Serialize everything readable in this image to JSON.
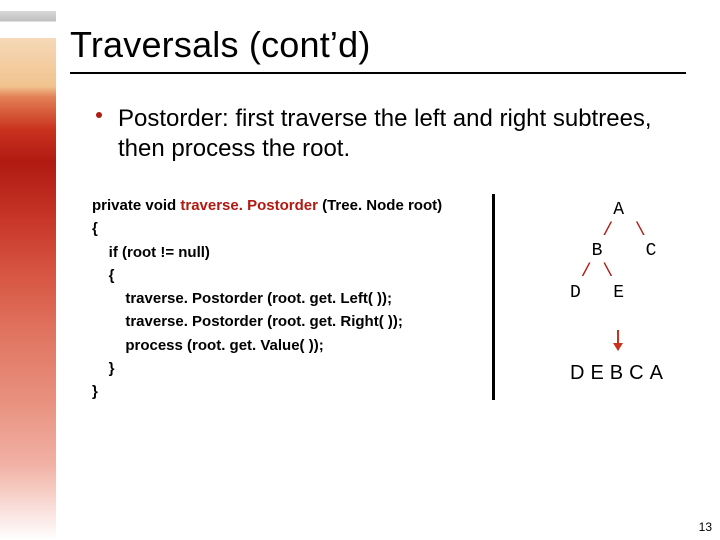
{
  "title": "Traversals (cont’d)",
  "bullet": "Postorder: first traverse the left and right subtrees, then process the root.",
  "code": {
    "sig_prefix": "private void ",
    "method": "traverse. Postorder",
    "sig_suffix": " (Tree. Node root)",
    "brace_open": "{",
    "cond": "    if (root != null)",
    "brace_open2": "    {",
    "call_left": "        traverse. Postorder (root. get. Left( ));",
    "call_right": "        traverse. Postorder (root. get. Right( ));",
    "call_process": "        process (root. get. Value( ));",
    "brace_close2": "    }",
    "brace_close": "}"
  },
  "tree": {
    "l1": "    A",
    "l2_slash": "   /",
    "l2_back": "  \\",
    "l3": "  B    C",
    "l4_slash": " /",
    "l4_back": " \\",
    "l5": "D   E"
  },
  "output": "DEBCA",
  "page": "13"
}
